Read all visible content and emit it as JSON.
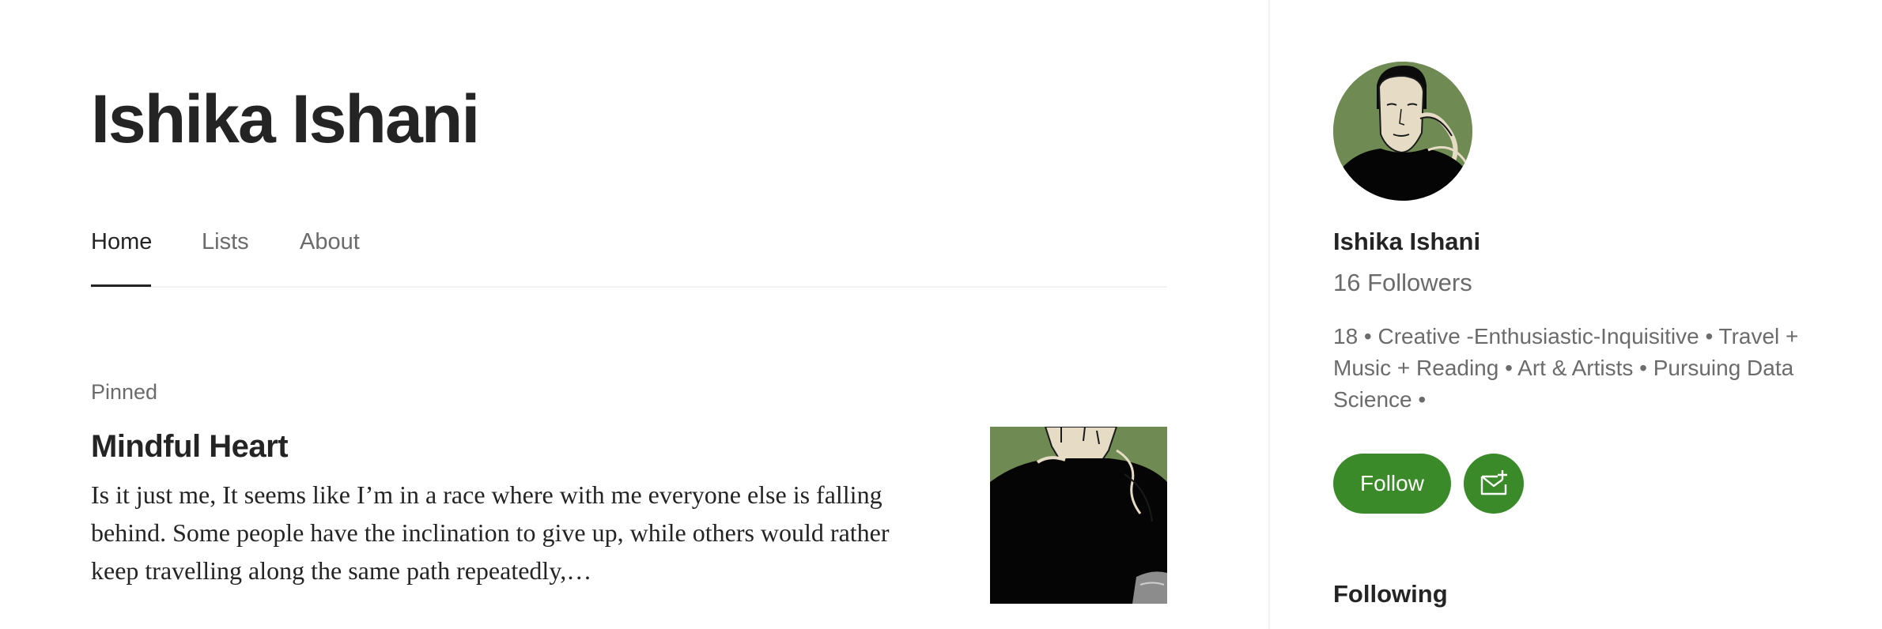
{
  "profile": {
    "name": "Ishika Ishani"
  },
  "tabs": [
    {
      "label": "Home",
      "active": true
    },
    {
      "label": "Lists",
      "active": false
    },
    {
      "label": "About",
      "active": false
    }
  ],
  "pinned": {
    "label": "Pinned",
    "title": "Mindful Heart",
    "excerpt": "Is it just me, It seems like I’m in a race where with me everyone else is falling behind. Some people have the inclination to give up, while others would rather keep travelling along the same path repeatedly,…"
  },
  "sidebar": {
    "name": "Ishika Ishani",
    "followers": "16 Followers",
    "bio": "18 • Creative -Enthusiastic-Inquisitive • Travel + Music + Reading • Art & Artists • Pursuing Data Science •",
    "follow_label": "Follow",
    "subscribe_icon": "mail-plus-icon",
    "following_heading": "Following"
  },
  "colors": {
    "accent_green": "#3a8a2a",
    "text_primary": "#242424",
    "text_secondary": "#6b6b6b",
    "avatar_bg": "#6f8a53"
  }
}
